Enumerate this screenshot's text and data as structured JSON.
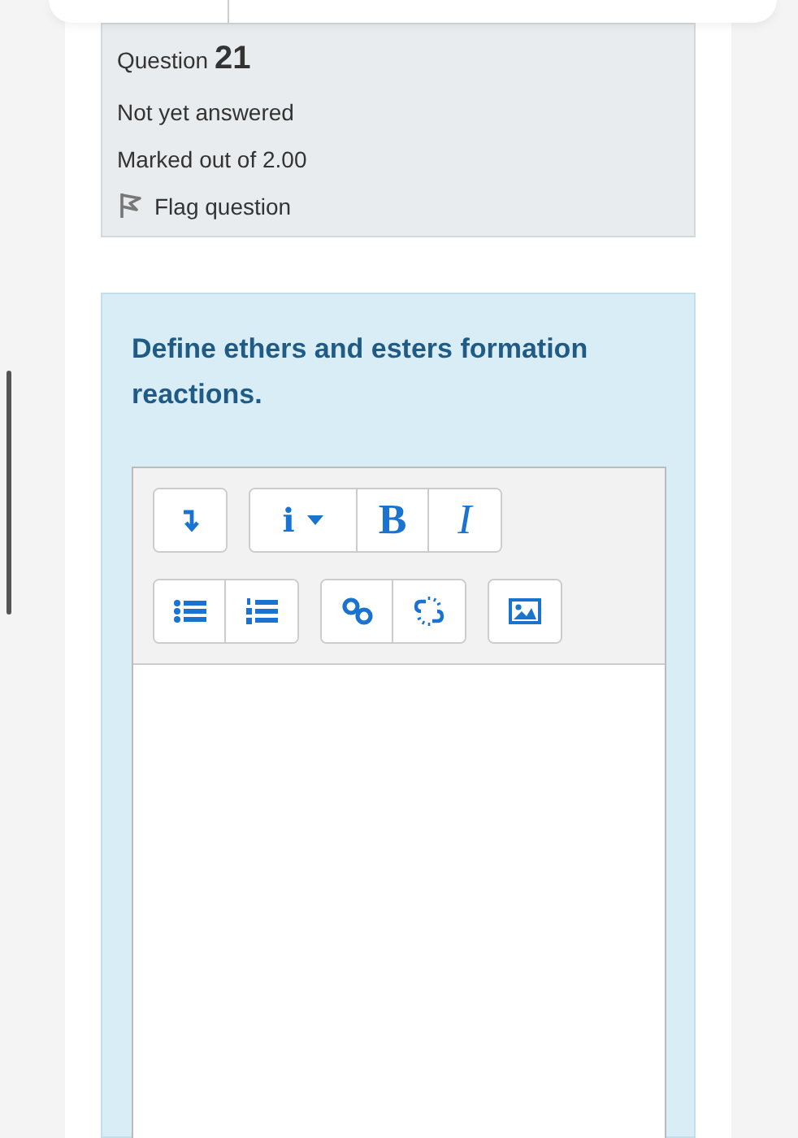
{
  "info": {
    "question_label": "Question",
    "question_number": "21",
    "status": "Not yet answered",
    "marks": "Marked out of 2.00",
    "flag_label": "Flag question"
  },
  "question": {
    "text": "Define ethers and esters formation reactions."
  },
  "editor": {
    "info_button": "i",
    "bold_button": "B",
    "italic_button": "I"
  }
}
